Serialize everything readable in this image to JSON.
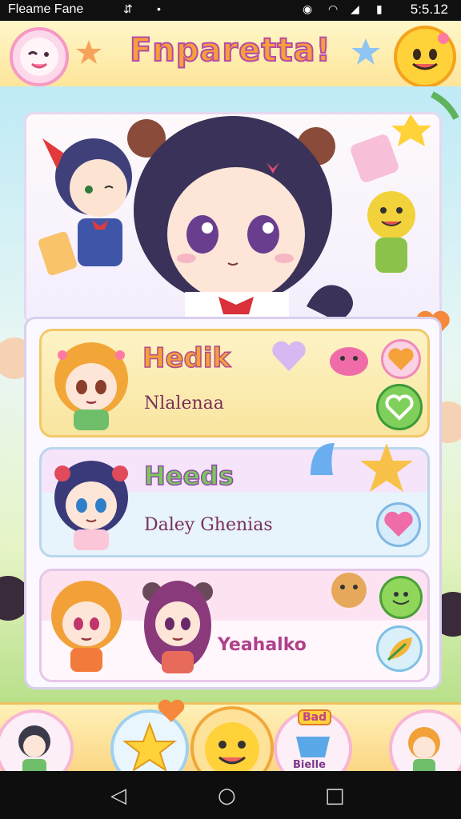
{
  "status_bar": {
    "carrier": "Fleame Fane",
    "time": "5:5.12"
  },
  "header": {
    "title": "Fnparetta!",
    "left_icon": "wink-face-icon",
    "right_icon": "smile-face-icon"
  },
  "list": [
    {
      "title": "Hedik",
      "subtitle": "Nlalenaa",
      "action_icon": "heart-icon",
      "action2_icon": "emoji-icon"
    },
    {
      "title": "Heeds",
      "subtitle": "Daley Ghenias",
      "action_icon": "heart-icon"
    },
    {
      "title": "",
      "subtitle": "Yeahalko",
      "action_icon": "emoji-icon",
      "action2_icon": "leaf-icon"
    }
  ],
  "bottom_nav": {
    "badge": "Bad",
    "badge_sub": "Bielle"
  },
  "colors": {
    "header_bg": "#fde59a",
    "title_fill": "#f6a03a",
    "title_stroke": "#b64aa7",
    "card1_bg": "#fcefb8",
    "card2_bg": "#e4f3fb",
    "card3_bg": "#fde7f4"
  }
}
